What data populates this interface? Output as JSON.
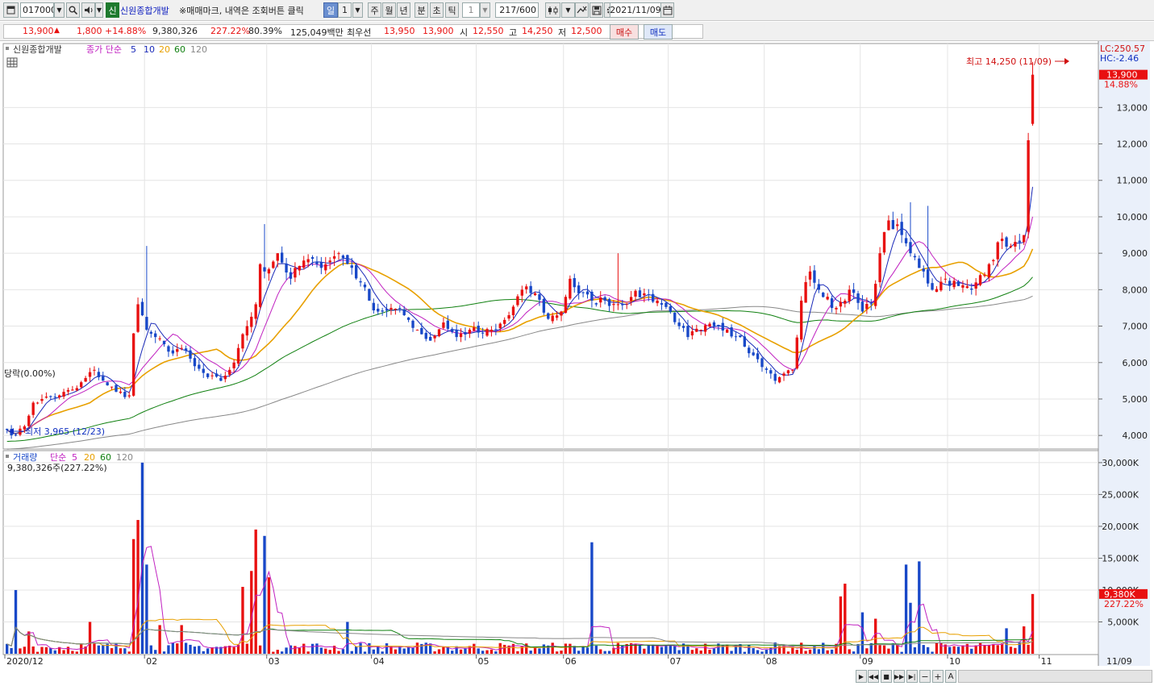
{
  "toolbar": {
    "code": "017000",
    "credit_badge": "신",
    "stock_name": "신원종합개발",
    "notice": "※매매마크, 내역은 조회버튼 클릭",
    "periods": [
      "일",
      "주",
      "월",
      "년",
      "분",
      "초",
      "틱"
    ],
    "period_selected": "일",
    "period_value": "1",
    "tick_value": "1",
    "count": "217/600",
    "date": "2021/11/09"
  },
  "quote": {
    "price": "13,900",
    "change": "1,800",
    "change_pct": "+14.88%",
    "volume": "9,380,326",
    "vol_ratio": "227.22%",
    "rate": "80.39%",
    "amount": "125,049백만",
    "best_label": "최우선",
    "best_ask": "13,950",
    "best_bid": "13,900",
    "open_label": "시",
    "open": "12,550",
    "high_label": "고",
    "high": "14,250",
    "low_label": "저",
    "low": "12,500",
    "buy_label": "매수",
    "sell_label": "매도"
  },
  "colors": {
    "up": "#e81010",
    "down": "#1848c8",
    "ma5": "#1828b8",
    "ma10": "#c020c0",
    "ma20": "#e8a000",
    "ma60": "#108010",
    "ma120": "#888888",
    "volume_up": "#e81010",
    "volume_down": "#1848c8"
  },
  "chart_data": {
    "type": "candlestick",
    "stock_name": "신원종합개발",
    "price_legend": {
      "name_label": "신원종합개발",
      "series_label": "종가 단순",
      "ma_periods": [
        "5",
        "10",
        "20",
        "60",
        "120"
      ]
    },
    "volume_legend": {
      "name_label": "거래량",
      "series_label": "단순",
      "ma_periods": [
        "5",
        "20",
        "60",
        "120"
      ],
      "current": "9,380,326주(227.22%)"
    },
    "price_axis": {
      "ylim": [
        3650,
        14600
      ],
      "ticks": [
        4000,
        5000,
        6000,
        7000,
        8000,
        9000,
        10000,
        11000,
        12000,
        13000
      ],
      "tick_labels": [
        "4,000",
        "5,000",
        "6,000",
        "7,000",
        "8,000",
        "9,000",
        "10,000",
        "11,000",
        "12,000",
        "13,000"
      ],
      "lc_label": "LC:250.57",
      "hc_label": "HC:-2.46",
      "current_price_label": "13,900",
      "current_change_label": "14.88%"
    },
    "volume_axis": {
      "ylim": [
        0,
        31000
      ],
      "ticks": [
        5000,
        10000,
        15000,
        20000,
        25000,
        30000
      ],
      "tick_labels": [
        "5,000K",
        "10,000K",
        "15,000K",
        "20,000K",
        "25,000K",
        "30,000K"
      ],
      "current_volume_label": "9,380K",
      "current_ratio_label": "227.22%"
    },
    "x_axis": {
      "labels": [
        "2020/12",
        "02",
        "03",
        "04",
        "05",
        "06",
        "07",
        "08",
        "09",
        "10",
        "11"
      ],
      "label_index": [
        0,
        32,
        60,
        84,
        108,
        128,
        152,
        174,
        196,
        216,
        237
      ],
      "end_label": "11/09",
      "slots": 250
    },
    "annotations": {
      "high": "최고 14,250 (11/09)",
      "low": "최저 3,965 (12/23)",
      "left": "당락(0.00%)"
    },
    "anchors": [
      {
        "i": 0,
        "c": 4150
      },
      {
        "i": 2,
        "c": 4000
      },
      {
        "i": 4,
        "c": 4250
      },
      {
        "i": 6,
        "c": 4900
      },
      {
        "i": 8,
        "c": 5000
      },
      {
        "i": 12,
        "c": 5100
      },
      {
        "i": 16,
        "c": 5300
      },
      {
        "i": 20,
        "c": 5800
      },
      {
        "i": 22,
        "c": 5500
      },
      {
        "i": 25,
        "c": 5200
      },
      {
        "i": 28,
        "c": 5100
      },
      {
        "i": 29,
        "c": 6800
      },
      {
        "i": 30,
        "c": 7600
      },
      {
        "i": 32,
        "c": 6900
      },
      {
        "i": 34,
        "c": 6700
      },
      {
        "i": 37,
        "c": 6300
      },
      {
        "i": 40,
        "c": 6400
      },
      {
        "i": 43,
        "c": 5900
      },
      {
        "i": 46,
        "c": 5600
      },
      {
        "i": 49,
        "c": 5500
      },
      {
        "i": 52,
        "c": 6000
      },
      {
        "i": 53,
        "c": 6400
      },
      {
        "i": 55,
        "c": 7000
      },
      {
        "i": 57,
        "c": 7600
      },
      {
        "i": 58,
        "c": 8700
      },
      {
        "i": 59,
        "c": 8500
      },
      {
        "i": 62,
        "c": 9000
      },
      {
        "i": 65,
        "c": 8300
      },
      {
        "i": 68,
        "c": 8800
      },
      {
        "i": 71,
        "c": 8700
      },
      {
        "i": 74,
        "c": 8800
      },
      {
        "i": 76,
        "c": 9000
      },
      {
        "i": 79,
        "c": 8600
      },
      {
        "i": 81,
        "c": 8200
      },
      {
        "i": 83,
        "c": 7700
      },
      {
        "i": 85,
        "c": 7400
      },
      {
        "i": 88,
        "c": 7500
      },
      {
        "i": 91,
        "c": 7300
      },
      {
        "i": 94,
        "c": 6900
      },
      {
        "i": 97,
        "c": 6600
      },
      {
        "i": 100,
        "c": 7100
      },
      {
        "i": 103,
        "c": 6700
      },
      {
        "i": 106,
        "c": 6900
      },
      {
        "i": 109,
        "c": 6800
      },
      {
        "i": 112,
        "c": 6900
      },
      {
        "i": 115,
        "c": 7300
      },
      {
        "i": 118,
        "c": 8000
      },
      {
        "i": 121,
        "c": 7900
      },
      {
        "i": 124,
        "c": 7200
      },
      {
        "i": 127,
        "c": 7400
      },
      {
        "i": 129,
        "c": 8300
      },
      {
        "i": 131,
        "c": 7900
      },
      {
        "i": 134,
        "c": 7700
      },
      {
        "i": 137,
        "c": 7700
      },
      {
        "i": 140,
        "c": 7600
      },
      {
        "i": 143,
        "c": 7800
      },
      {
        "i": 146,
        "c": 7900
      },
      {
        "i": 149,
        "c": 7700
      },
      {
        "i": 152,
        "c": 7400
      },
      {
        "i": 154,
        "c": 7000
      },
      {
        "i": 156,
        "c": 6700
      },
      {
        "i": 159,
        "c": 6900
      },
      {
        "i": 162,
        "c": 7000
      },
      {
        "i": 165,
        "c": 6900
      },
      {
        "i": 168,
        "c": 6700
      },
      {
        "i": 171,
        "c": 6200
      },
      {
        "i": 174,
        "c": 5800
      },
      {
        "i": 176,
        "c": 5500
      },
      {
        "i": 178,
        "c": 5700
      },
      {
        "i": 180,
        "c": 5800
      },
      {
        "i": 182,
        "c": 7700
      },
      {
        "i": 184,
        "c": 8500
      },
      {
        "i": 187,
        "c": 7800
      },
      {
        "i": 190,
        "c": 7500
      },
      {
        "i": 193,
        "c": 8000
      },
      {
        "i": 196,
        "c": 7400
      },
      {
        "i": 198,
        "c": 7600
      },
      {
        "i": 200,
        "c": 9000
      },
      {
        "i": 202,
        "c": 9900
      },
      {
        "i": 205,
        "c": 9500
      },
      {
        "i": 207,
        "c": 9000
      },
      {
        "i": 210,
        "c": 8500
      },
      {
        "i": 212,
        "c": 8000
      },
      {
        "i": 215,
        "c": 8300
      },
      {
        "i": 218,
        "c": 8100
      },
      {
        "i": 221,
        "c": 8000
      },
      {
        "i": 223,
        "c": 8400
      },
      {
        "i": 225,
        "c": 8700
      },
      {
        "i": 228,
        "c": 9400
      },
      {
        "i": 230,
        "c": 9200
      },
      {
        "i": 232,
        "c": 9300
      },
      {
        "i": 233,
        "c": 9500
      },
      {
        "i": 234,
        "c": 12100
      },
      {
        "i": 235,
        "c": 13900
      }
    ],
    "last_candle": {
      "date": "11/09",
      "open": 12550,
      "high": 14250,
      "low": 12500,
      "close": 13900
    },
    "volume_spikes": [
      {
        "i": 2,
        "v": 10000
      },
      {
        "i": 5,
        "v": 3500
      },
      {
        "i": 19,
        "v": 5000
      },
      {
        "i": 29,
        "v": 18000
      },
      {
        "i": 30,
        "v": 21000
      },
      {
        "i": 31,
        "v": 30000
      },
      {
        "i": 32,
        "v": 14000
      },
      {
        "i": 35,
        "v": 4500
      },
      {
        "i": 40,
        "v": 4500
      },
      {
        "i": 54,
        "v": 10500
      },
      {
        "i": 56,
        "v": 13000
      },
      {
        "i": 57,
        "v": 19500
      },
      {
        "i": 59,
        "v": 18500
      },
      {
        "i": 60,
        "v": 12000
      },
      {
        "i": 78,
        "v": 5000
      },
      {
        "i": 134,
        "v": 17500
      },
      {
        "i": 191,
        "v": 9000
      },
      {
        "i": 192,
        "v": 11000
      },
      {
        "i": 196,
        "v": 6500
      },
      {
        "i": 199,
        "v": 5500
      },
      {
        "i": 206,
        "v": 14000
      },
      {
        "i": 207,
        "v": 8000
      },
      {
        "i": 209,
        "v": 14500
      },
      {
        "i": 229,
        "v": 4000
      },
      {
        "i": 233,
        "v": 4300
      },
      {
        "i": 235,
        "v": 9380
      }
    ]
  }
}
